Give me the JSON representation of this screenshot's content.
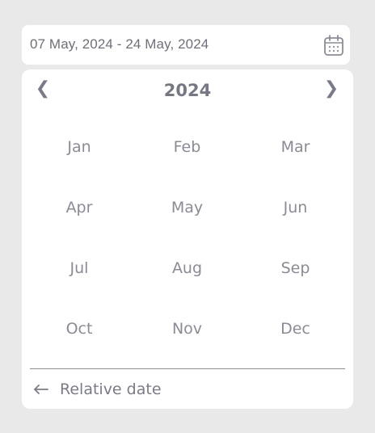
{
  "date_input": {
    "value": "07 May, 2024 - 24 May, 2024",
    "icon": "calendar-icon"
  },
  "picker": {
    "year": "2024",
    "prev_icon": "❮",
    "next_icon": "❯",
    "months": [
      "Jan",
      "Feb",
      "Mar",
      "Apr",
      "May",
      "Jun",
      "Jul",
      "Aug",
      "Sep",
      "Oct",
      "Nov",
      "Dec"
    ],
    "footer": {
      "icon": "arrow-left-icon",
      "label": "Relative date"
    }
  },
  "colors": {
    "background": "#e9e9ea",
    "surface": "#ffffff",
    "text": "#7a7b88",
    "month_text": "#8a8b96"
  }
}
